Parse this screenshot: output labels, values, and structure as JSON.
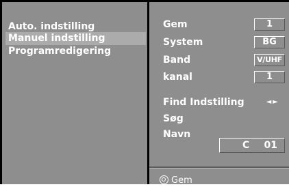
{
  "left_menu": {
    "items": [
      {
        "label": "Auto. indstilling",
        "selected": false
      },
      {
        "label": "Manuel indstilling",
        "selected": true
      },
      {
        "label": "Programredigering",
        "selected": false
      }
    ]
  },
  "settings": {
    "gem": {
      "label": "Gem",
      "value": "1"
    },
    "system": {
      "label": "System",
      "value": "BG"
    },
    "band": {
      "label": "Band",
      "value": "V/UHF"
    },
    "kanal": {
      "label": "kanal",
      "value": "1"
    },
    "find": {
      "label": "Find Indstilling",
      "arrows": "◄►"
    },
    "sog": {
      "label": "Søg"
    },
    "navn": {
      "label": "Navn",
      "value_prefix": "C",
      "value_number": "01"
    }
  },
  "footer": {
    "label": "Gem",
    "icon": "ok-button-icon"
  },
  "colors": {
    "panel": "#8e8e8e",
    "selected": "#ababab",
    "frame": "#000000",
    "text": "#ffffff"
  }
}
